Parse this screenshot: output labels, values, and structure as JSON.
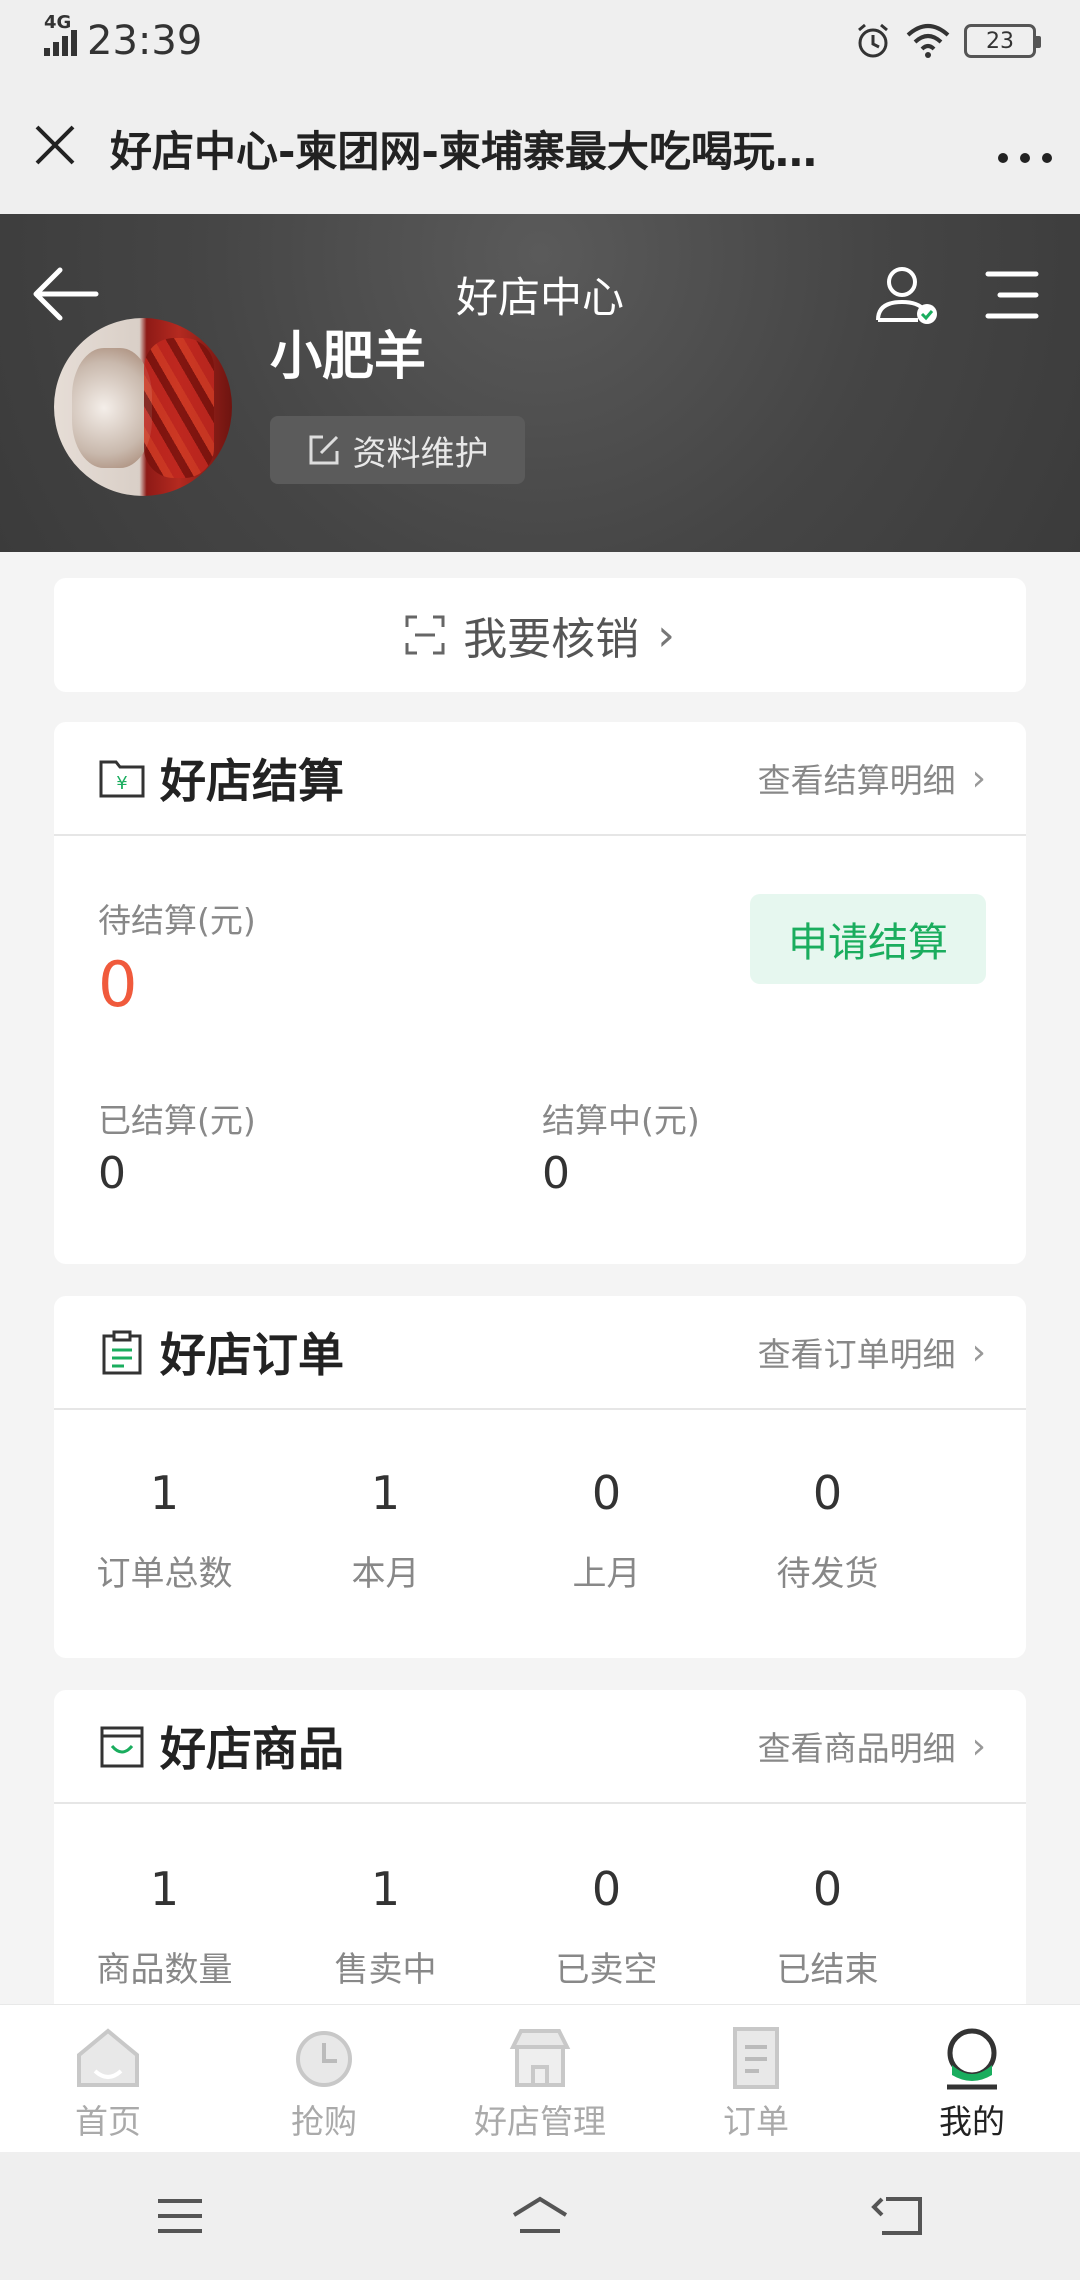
{
  "status": {
    "network": "4G",
    "time": "23:39",
    "battery": "23"
  },
  "browser": {
    "title": "好店中心-柬团网-柬埔寨最大吃喝玩…"
  },
  "header": {
    "title": "好店中心",
    "shop_name": "小肥羊",
    "maintain_label": "资料维护"
  },
  "verify": {
    "label": "我要核销"
  },
  "settlement": {
    "title": "好店结算",
    "link": "查看结算明细",
    "pending_label": "待结算(元)",
    "pending_value": "0",
    "apply_button": "申请结算",
    "settled_label": "已结算(元)",
    "settled_value": "0",
    "in_progress_label": "结算中(元)",
    "in_progress_value": "0"
  },
  "orders": {
    "title": "好店订单",
    "link": "查看订单明细",
    "stats": [
      {
        "value": "1",
        "label": "订单总数"
      },
      {
        "value": "1",
        "label": "本月"
      },
      {
        "value": "0",
        "label": "上月"
      },
      {
        "value": "0",
        "label": "待发货"
      }
    ]
  },
  "goods": {
    "title": "好店商品",
    "link": "查看商品明细",
    "stats": [
      {
        "value": "1",
        "label": "商品数量"
      },
      {
        "value": "1",
        "label": "售卖中"
      },
      {
        "value": "0",
        "label": "已卖空"
      },
      {
        "value": "0",
        "label": "已结束"
      }
    ]
  },
  "tabbar": {
    "items": [
      {
        "label": "首页",
        "icon": "home-icon"
      },
      {
        "label": "抢购",
        "icon": "flash-sale-icon"
      },
      {
        "label": "好店管理",
        "icon": "store-icon"
      },
      {
        "label": "订单",
        "icon": "order-icon"
      },
      {
        "label": "我的",
        "icon": "profile-icon"
      }
    ],
    "active": "我的"
  },
  "colors": {
    "accent_green": "#1aad5e",
    "amount_red": "#f05a3c",
    "header_dark": "#444444"
  }
}
